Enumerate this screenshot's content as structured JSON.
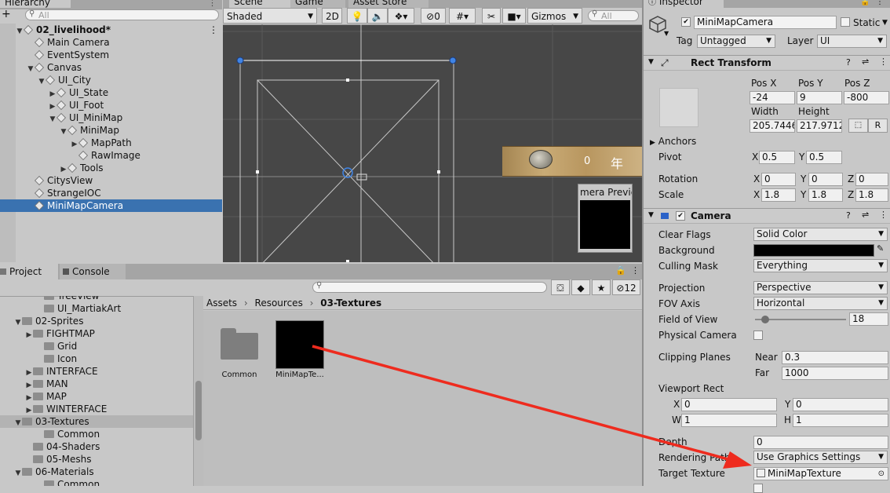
{
  "hierarchy": {
    "tab": "Hierarchy",
    "search_placeholder": "All",
    "add_label": "+",
    "rows": [
      {
        "label": "02_livelihood*",
        "arrow": "▼",
        "icon": "scene"
      },
      {
        "label": "Main Camera",
        "arrow": "",
        "icon": "cube"
      },
      {
        "label": "EventSystem",
        "arrow": "",
        "icon": "cube"
      },
      {
        "label": "Canvas",
        "arrow": "▼",
        "icon": "cube"
      },
      {
        "label": "UI_City",
        "arrow": "▼",
        "icon": "cube"
      },
      {
        "label": "UI_State",
        "arrow": "▶",
        "icon": "cube"
      },
      {
        "label": "UI_Foot",
        "arrow": "▶",
        "icon": "cube"
      },
      {
        "label": "UI_MiniMap",
        "arrow": "▼",
        "icon": "cube"
      },
      {
        "label": "MiniMap",
        "arrow": "▼",
        "icon": "cube"
      },
      {
        "label": "MapPath",
        "arrow": "▶",
        "icon": "cube"
      },
      {
        "label": "RawImage",
        "arrow": "",
        "icon": "cube"
      },
      {
        "label": "Tools",
        "arrow": "▶",
        "icon": "cube"
      },
      {
        "label": "CitysView",
        "arrow": "",
        "icon": "cube"
      },
      {
        "label": "StrangeIOC",
        "arrow": "",
        "icon": "cube"
      },
      {
        "label": "MiniMapCamera",
        "arrow": "",
        "icon": "cube"
      }
    ]
  },
  "scene": {
    "tabs": [
      "Scene",
      "Game",
      "Asset Store"
    ],
    "shading": "Shaded",
    "mode_2d": "2D",
    "hidden_count": "0",
    "gizmos": "Gizmos",
    "search_placeholder": "All",
    "overlay_number": "0",
    "overlay_char": "年",
    "preview_title": "mera Previe"
  },
  "project": {
    "tabs": [
      "Project",
      "Console"
    ],
    "hidden_count": "12",
    "tree": [
      {
        "label": "TreeView",
        "arrow": "",
        "icon": "folder"
      },
      {
        "label": "UI_MartiakArt",
        "arrow": "",
        "icon": "folder"
      },
      {
        "label": "02-Sprites",
        "arrow": "▼",
        "icon": "folder"
      },
      {
        "label": "FIGHTMAP",
        "arrow": "▶",
        "icon": "folder"
      },
      {
        "label": "Grid",
        "arrow": "",
        "icon": "folder"
      },
      {
        "label": "Icon",
        "arrow": "",
        "icon": "folder"
      },
      {
        "label": "INTERFACE",
        "arrow": "▶",
        "icon": "folder"
      },
      {
        "label": "MAN",
        "arrow": "▶",
        "icon": "folder"
      },
      {
        "label": "MAP",
        "arrow": "▶",
        "icon": "folder"
      },
      {
        "label": "WINTERFACE",
        "arrow": "▶",
        "icon": "folder"
      },
      {
        "label": "03-Textures",
        "arrow": "▼",
        "icon": "folder"
      },
      {
        "label": "Common",
        "arrow": "",
        "icon": "folder"
      },
      {
        "label": "04-Shaders",
        "arrow": "",
        "icon": "folder"
      },
      {
        "label": "05-Meshs",
        "arrow": "",
        "icon": "folder"
      },
      {
        "label": "06-Materials",
        "arrow": "▼",
        "icon": "folder"
      },
      {
        "label": "Common",
        "arrow": "",
        "icon": "folder"
      }
    ],
    "breadcrumb": [
      "Assets",
      "Resources",
      "03-Textures"
    ],
    "assets": [
      {
        "label": "Common",
        "type": "folder"
      },
      {
        "label": "MiniMapTe...",
        "type": "texture"
      }
    ]
  },
  "inspector": {
    "tab": "Inspector",
    "object_name": "MiniMapCamera",
    "static_label": "Static",
    "tag_label": "Tag",
    "tag_value": "Untagged",
    "layer_label": "Layer",
    "layer_value": "UI",
    "rect_transform": {
      "title": "Rect Transform",
      "pos_x_label": "Pos X",
      "pos_y_label": "Pos Y",
      "pos_z_label": "Pos Z",
      "pos_x": "-24",
      "pos_y": "9",
      "pos_z": "-800",
      "width_label": "Width",
      "height_label": "Height",
      "width": "205.7446",
      "height": "217.9712",
      "r_label": "R",
      "anchors_label": "Anchors",
      "pivot_label": "Pivot",
      "pivot_x": "0.5",
      "pivot_y": "0.5",
      "rotation_label": "Rotation",
      "rot_x": "0",
      "rot_y": "0",
      "rot_z": "0",
      "scale_label": "Scale",
      "scale_x": "1.8",
      "scale_y": "1.8",
      "scale_z": "1.8"
    },
    "camera": {
      "title": "Camera",
      "clear_flags_label": "Clear Flags",
      "clear_flags": "Solid Color",
      "background_label": "Background",
      "background_color": "#000000",
      "culling_mask_label": "Culling Mask",
      "culling_mask": "Everything",
      "projection_label": "Projection",
      "projection": "Perspective",
      "fov_axis_label": "FOV Axis",
      "fov_axis": "Horizontal",
      "fov_label": "Field of View",
      "fov": "18",
      "physical_label": "Physical Camera",
      "clipping_label": "Clipping Planes",
      "near_label": "Near",
      "near": "0.3",
      "far_label": "Far",
      "far": "1000",
      "viewport_label": "Viewport Rect",
      "vx": "0",
      "vy": "0",
      "vw": "1",
      "vh": "1",
      "depth_label": "Depth",
      "depth": "0",
      "rendering_label": "Rendering Path",
      "rendering": "Use Graphics Settings",
      "target_label": "Target Texture",
      "target": "MiniMapTexture"
    },
    "axis": {
      "x": "X",
      "y": "Y",
      "z": "Z",
      "w": "W",
      "h": "H"
    }
  },
  "colors": {
    "selection": "#3a72b0",
    "arrow": "#ee2b1e",
    "scene_bg": "#474747"
  }
}
